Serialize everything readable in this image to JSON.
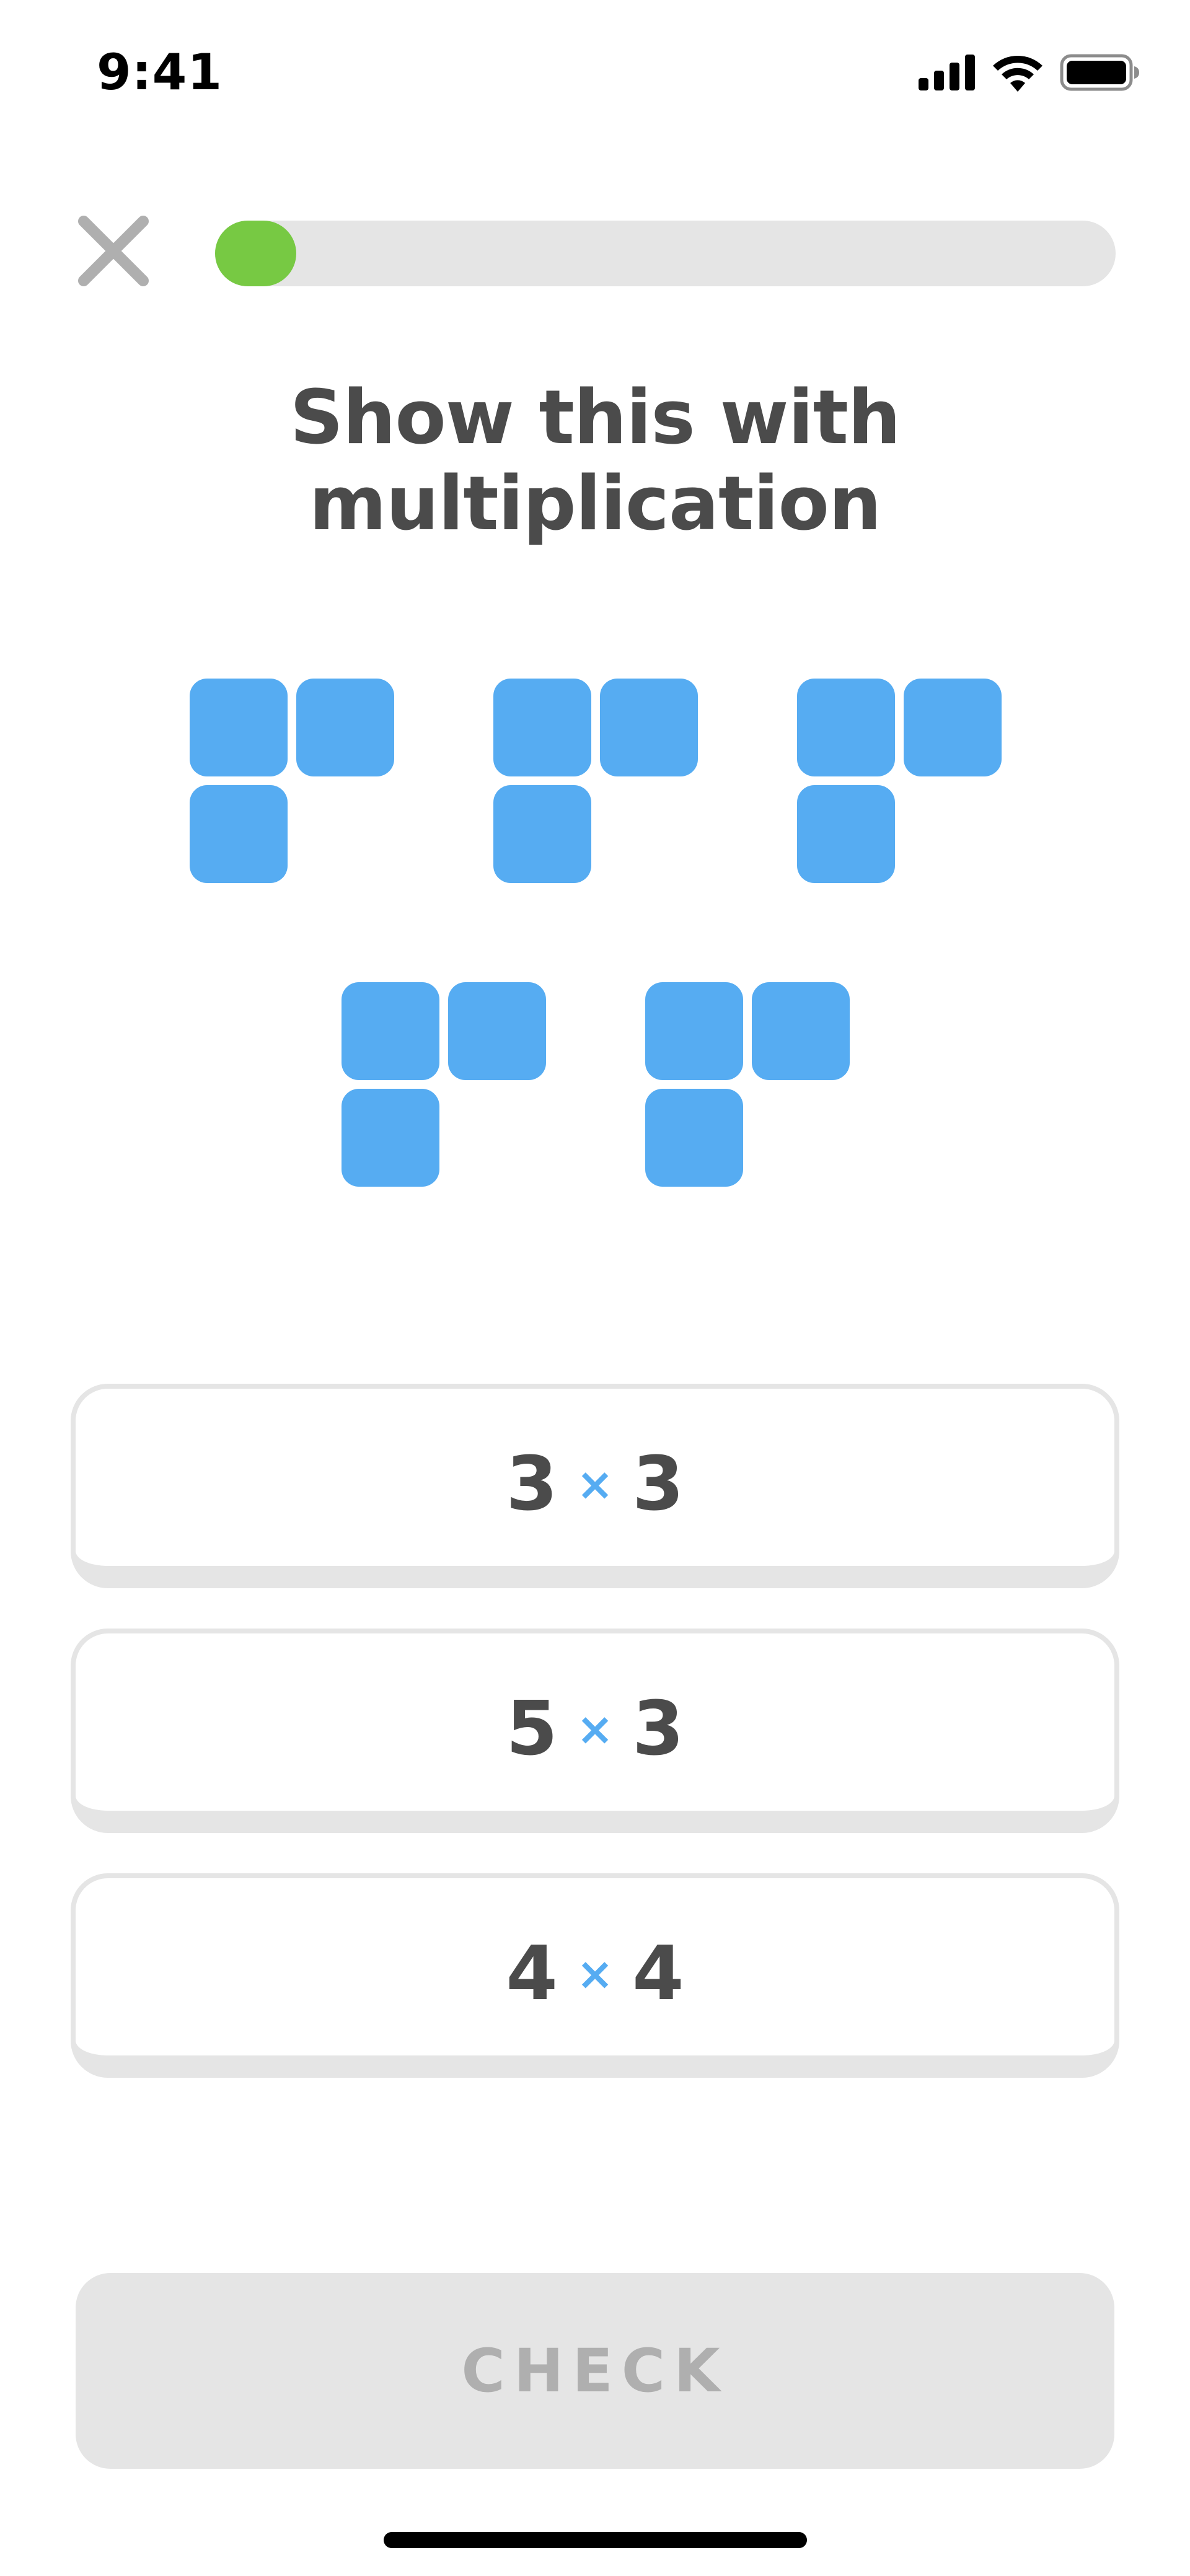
{
  "status_bar": {
    "time": "9:41",
    "icons": [
      "cellular-signal-icon",
      "wifi-icon",
      "battery-icon"
    ]
  },
  "header": {
    "close_icon": "close-icon",
    "progress_fraction": 0.09
  },
  "prompt": "Show this with multiplication",
  "visual": {
    "group_count": 5,
    "blocks_per_group": 3,
    "block_color": "#56acf2"
  },
  "options": [
    {
      "left": "3",
      "operator": "×",
      "right": "3"
    },
    {
      "left": "5",
      "operator": "×",
      "right": "3"
    },
    {
      "left": "4",
      "operator": "×",
      "right": "4"
    }
  ],
  "check_button": {
    "label": "CHECK",
    "enabled": false
  },
  "colors": {
    "progress": "#77c943",
    "track": "#e5e5e5",
    "text": "#4b4b4b",
    "accent_blue": "#56acf2",
    "disabled_text": "#afafaf"
  }
}
